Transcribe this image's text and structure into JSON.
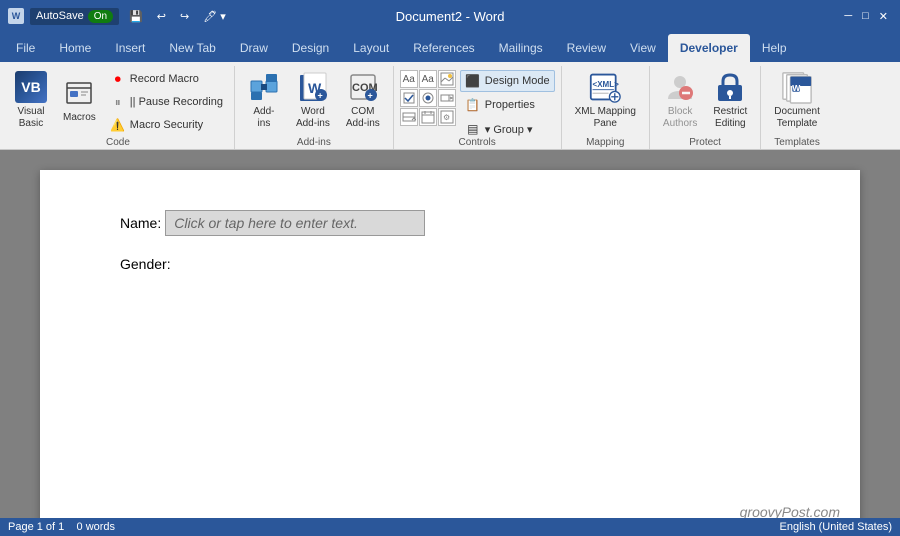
{
  "titleBar": {
    "autosave": "AutoSave",
    "autosaveState": "On",
    "title": "Document2 - Word",
    "windowControls": [
      "─",
      "□",
      "✕"
    ]
  },
  "ribbonTabs": [
    {
      "label": "File",
      "active": false
    },
    {
      "label": "Home",
      "active": false
    },
    {
      "label": "Insert",
      "active": false
    },
    {
      "label": "New Tab",
      "active": false
    },
    {
      "label": "Draw",
      "active": false
    },
    {
      "label": "Design",
      "active": false
    },
    {
      "label": "Layout",
      "active": false
    },
    {
      "label": "References",
      "active": false
    },
    {
      "label": "Mailings",
      "active": false
    },
    {
      "label": "Review",
      "active": false
    },
    {
      "label": "View",
      "active": false
    },
    {
      "label": "Developer",
      "active": true
    },
    {
      "label": "Help",
      "active": false
    }
  ],
  "ribbon": {
    "groups": [
      {
        "name": "Code",
        "label": "Code",
        "items": [
          {
            "id": "visual-basic",
            "label": "Visual\nBasic",
            "type": "large"
          },
          {
            "id": "macros",
            "label": "Macros",
            "type": "large"
          },
          {
            "id": "record-macro",
            "label": "Record Macro",
            "type": "small"
          },
          {
            "id": "pause-recording",
            "label": "|| Pause Recording",
            "type": "small"
          },
          {
            "id": "macro-security",
            "label": "Macro Security",
            "type": "small",
            "hasWarning": true
          }
        ]
      },
      {
        "name": "Add-ins",
        "label": "Add-ins",
        "items": [
          {
            "id": "add-ins",
            "label": "Add-\nins",
            "type": "large"
          },
          {
            "id": "word-add-ins",
            "label": "Word\nAdd-ins",
            "type": "large"
          },
          {
            "id": "com-add-ins",
            "label": "COM\nAdd-ins",
            "type": "large"
          }
        ]
      },
      {
        "name": "Controls",
        "label": "Controls",
        "items": [
          {
            "id": "design-mode",
            "label": "Design Mode",
            "type": "small-right"
          },
          {
            "id": "properties",
            "label": "Properties",
            "type": "small-right"
          },
          {
            "id": "group",
            "label": "▾ Group ▾",
            "type": "small-right"
          }
        ]
      },
      {
        "name": "Mapping",
        "label": "Mapping",
        "items": [
          {
            "id": "xml-mapping-pane",
            "label": "XML Mapping\nPane",
            "type": "large"
          }
        ]
      },
      {
        "name": "Protect",
        "label": "Protect",
        "items": [
          {
            "id": "block-authors",
            "label": "Block\nAuthors",
            "type": "large",
            "disabled": true
          },
          {
            "id": "restrict-editing",
            "label": "Restrict\nEditing",
            "type": "large"
          }
        ]
      },
      {
        "name": "Templates",
        "label": "Templates",
        "items": [
          {
            "id": "document-template",
            "label": "Document\nTemplate",
            "type": "large"
          }
        ]
      }
    ]
  },
  "document": {
    "nameLabel": "Name:",
    "namePlaceholder": "Click or tap here to enter text.",
    "genderLabel": "Gender:"
  },
  "statusBar": {
    "pageInfo": "Page 1 of 1",
    "words": "0 words",
    "language": "English (United States)"
  },
  "watermark": "groovyPost.com"
}
